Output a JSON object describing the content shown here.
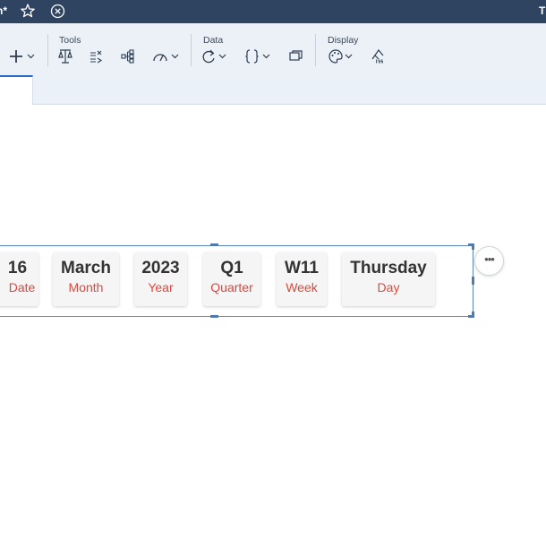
{
  "titlebar": {
    "title": "n*",
    "right_letter": "T",
    "favorite_icon": "star-icon",
    "close_icon": "close-circle-icon",
    "background": "#2f4460"
  },
  "toolbar": {
    "groups": {
      "tools": "Tools",
      "data": "Data",
      "display": "Display"
    },
    "icons": [
      "plus-icon",
      "scale-icon",
      "formula-icon",
      "hierarchy-icon",
      "gauge-icon",
      "refresh-icon",
      "braces-icon",
      "copy-icon",
      "palette-icon",
      "css-icon"
    ]
  },
  "widget": {
    "cards": [
      {
        "value": "16",
        "label": "Date"
      },
      {
        "value": "March",
        "label": "Month"
      },
      {
        "value": "2023",
        "label": "Year"
      },
      {
        "value": "Q1",
        "label": "Quarter"
      },
      {
        "value": "W11",
        "label": "Week"
      },
      {
        "value": "Thursday",
        "label": "Day"
      }
    ],
    "more_label": "•••",
    "label_color": "#e0463c",
    "selection_color": "#5b86b6"
  }
}
